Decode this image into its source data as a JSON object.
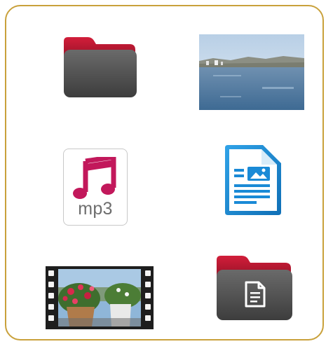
{
  "colors": {
    "frame_border": "#c9a13b",
    "folder_tab": "#b3162e",
    "folder_body": "#4d4d4d",
    "music_note": "#c2185b",
    "doc_blue": "#1a8ad6",
    "film_black": "#1e1e1e"
  },
  "grid": {
    "items": [
      {
        "icon": "folder-icon",
        "kind": "folder"
      },
      {
        "icon": "landscape-photo-icon",
        "kind": "image"
      },
      {
        "icon": "mp3-file-icon",
        "kind": "audio",
        "label": "mp3"
      },
      {
        "icon": "document-file-icon",
        "kind": "document"
      },
      {
        "icon": "video-file-icon",
        "kind": "video"
      },
      {
        "icon": "document-folder-icon",
        "kind": "folder"
      }
    ]
  }
}
